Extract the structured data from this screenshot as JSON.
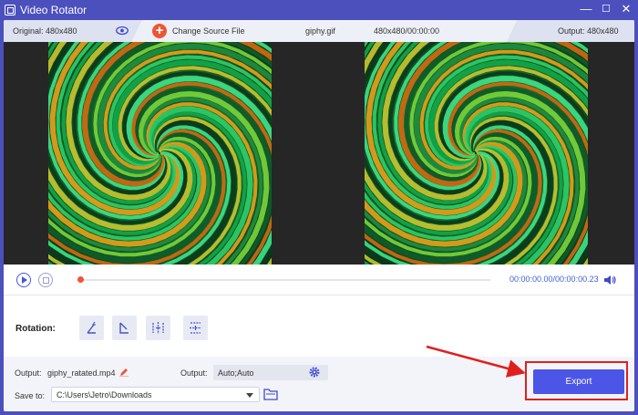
{
  "window": {
    "title": "Video Rotator",
    "controls": [
      "minimize-icon",
      "maximize-icon",
      "close-icon"
    ]
  },
  "topbar": {
    "original_label": "Original: 480x480",
    "change_source_label": "Change Source File",
    "file_name": "giphy.gif",
    "file_info": "480x480/00:00:00",
    "output_label": "Output: 480x480"
  },
  "player": {
    "time": "00:00:00.00/00:00:00.23",
    "progress_fraction": 0.0
  },
  "rotation": {
    "label": "Rotation:",
    "buttons": [
      "rotate-left-icon",
      "rotate-right-icon",
      "flip-horizontal-icon",
      "flip-vertical-icon"
    ]
  },
  "output": {
    "file_label": "Output:",
    "file_name": "giphy_ratated.mp4",
    "format_label": "Output:",
    "format_value": "Auto;Auto",
    "save_label": "Save to:",
    "save_path": "C:\\Users\\Jetro\\Downloads",
    "export_label": "Export"
  },
  "colors": {
    "accent": "#4b55e6",
    "frame": "#4b50bc",
    "highlight": "#e01f1f",
    "time": "#3d5fd6"
  }
}
